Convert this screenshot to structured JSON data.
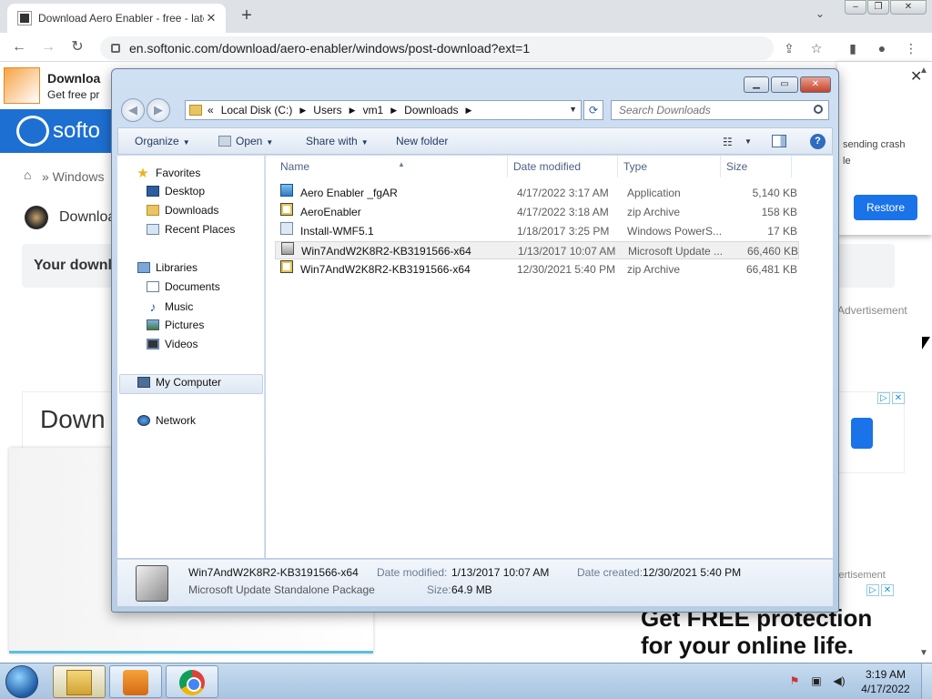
{
  "browser": {
    "tab_title": "Download Aero Enabler - free - late",
    "tab_close": "✕",
    "new_tab": "+",
    "tab_search": "⌄",
    "url": "en.softonic.com/download/aero-enabler/windows/post-download?ext=1",
    "window_controls": {
      "minimize": "–",
      "maximize": "❐",
      "close": "✕"
    },
    "nav": {
      "back": "←",
      "forward": "→",
      "reload": "↻"
    },
    "toolbar_icons": {
      "share": "⇪",
      "bookmark": "☆",
      "side_panel": "▮",
      "profile": "●",
      "menu": "⋮"
    }
  },
  "page": {
    "sponsor_title": "Downloa",
    "sponsor_subtitle": "Get free pr",
    "brand": "softo",
    "breadcrumb_home": "⌂",
    "breadcrumb_windows": "» Windows",
    "heading": "Downloa",
    "download_box_text": "Your downlo",
    "ad_label_1": "Advertisement",
    "ad_box_title": "Down",
    "ad_label_2": "vertisement",
    "ad_headline_1": "Get FREE protection",
    "ad_headline_2": "for your online life.",
    "adchoices": "▷",
    "adclose": "✕"
  },
  "restore_popup": {
    "close": "✕",
    "text": "sending crash\nle",
    "button": "Restore"
  },
  "explorer": {
    "caption_buttons": {
      "minimize": "▁",
      "maximize": "▭",
      "close": "✕"
    },
    "nav": {
      "back": "◀",
      "forward": "▶"
    },
    "address": {
      "chevron": "«",
      "crumbs": [
        "Local Disk (C:)",
        "Users",
        "vm1",
        "Downloads"
      ],
      "separator": "▶",
      "dropdown": "▼",
      "refresh": "⟳"
    },
    "search_placeholder": "Search Downloads",
    "commands": {
      "organize": "Organize",
      "open": "Open",
      "share_with": "Share with",
      "new_folder": "New folder",
      "arrow": "▼",
      "views": "☷",
      "help": "?"
    },
    "nav_pane": {
      "favorites": "Favorites",
      "desktop": "Desktop",
      "downloads": "Downloads",
      "recent_places": "Recent Places",
      "libraries": "Libraries",
      "documents": "Documents",
      "music": "Music",
      "pictures": "Pictures",
      "videos": "Videos",
      "my_computer": "My Computer",
      "network": "Network",
      "star": "★",
      "note": "♪"
    },
    "columns": {
      "name": "Name",
      "date_modified": "Date modified",
      "type": "Type",
      "size": "Size",
      "sort": "▲"
    },
    "files": [
      {
        "name": "Aero Enabler _fgAR",
        "date": "4/17/2022 3:17 AM",
        "type": "Application",
        "size": "5,140 KB",
        "icon": "app-icon"
      },
      {
        "name": "AeroEnabler",
        "date": "4/17/2022 3:18 AM",
        "type": "zip Archive",
        "size": "158 KB",
        "icon": "zip-icon"
      },
      {
        "name": "Install-WMF5.1",
        "date": "1/18/2017 3:25 PM",
        "type": "Windows PowerS...",
        "size": "17 KB",
        "icon": "powershell-icon"
      },
      {
        "name": "Win7AndW2K8R2-KB3191566-x64",
        "date": "1/13/2017 10:07 AM",
        "type": "Microsoft Update ...",
        "size": "66,460 KB",
        "icon": "update-package-icon"
      },
      {
        "name": "Win7AndW2K8R2-KB3191566-x64",
        "date": "12/30/2021 5:40 PM",
        "type": "zip Archive",
        "size": "66,481 KB",
        "icon": "zip-icon"
      }
    ],
    "details": {
      "name": "Win7AndW2K8R2-KB3191566-x64",
      "type": "Microsoft Update Standalone Package",
      "date_modified_label": "Date modified:",
      "date_modified": "1/13/2017 10:07 AM",
      "date_created_label": "Date created:",
      "date_created": "12/30/2021 5:40 PM",
      "size_label": "Size:",
      "size": "64.9 MB"
    }
  },
  "taskbar": {
    "clock_time": "3:19 AM",
    "clock_date": "4/17/2022",
    "tray": {
      "flag": "⚑",
      "network": "▣",
      "volume": "◀)"
    }
  },
  "scroll": {
    "up": "▲",
    "down": "▼"
  }
}
